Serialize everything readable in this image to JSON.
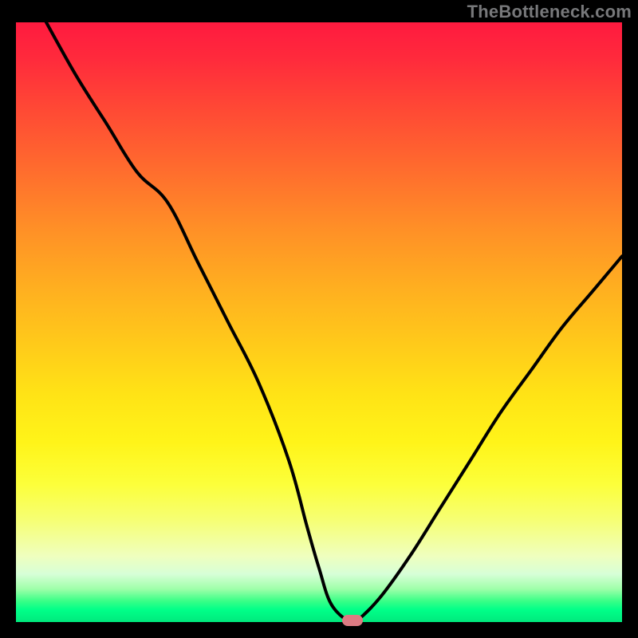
{
  "watermark": "TheBottleneck.com",
  "chart_data": {
    "type": "line",
    "title": "",
    "xlabel": "",
    "ylabel": "",
    "xlim": [
      0,
      100
    ],
    "ylim": [
      0,
      100
    ],
    "grid": false,
    "series": [
      {
        "name": "curve",
        "x": [
          5,
          10,
          15,
          20,
          25,
          30,
          35,
          40,
          45,
          48,
          50,
          52,
          55,
          56,
          60,
          65,
          70,
          75,
          80,
          85,
          90,
          95,
          100
        ],
        "values": [
          100,
          91,
          83,
          75,
          70,
          60,
          50,
          40,
          27,
          16,
          9,
          3,
          0,
          0,
          4,
          11,
          19,
          27,
          35,
          42,
          49,
          55,
          61
        ]
      }
    ],
    "marker": {
      "x": 55.5,
      "y": 0,
      "color": "#dd7a82"
    },
    "gradient_stops": [
      {
        "pos": 0,
        "color": "#ff1a3f"
      },
      {
        "pos": 0.5,
        "color": "#ffe316"
      },
      {
        "pos": 0.9,
        "color": "#efffbe"
      },
      {
        "pos": 1.0,
        "color": "#00e97d"
      }
    ]
  }
}
